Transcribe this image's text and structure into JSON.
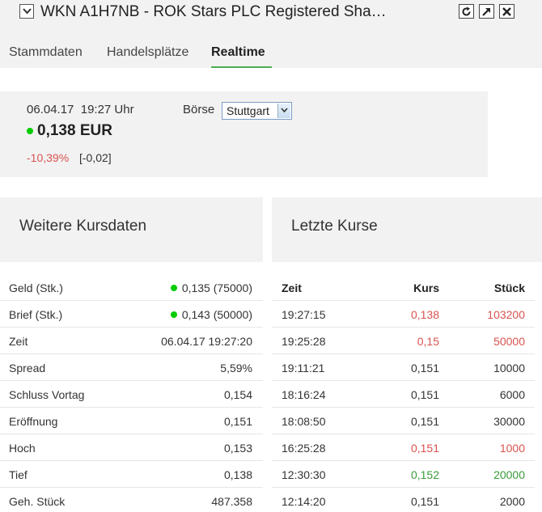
{
  "window": {
    "title": "WKN A1H7NB - ROK Stars PLC Registered Sha…",
    "icons": [
      "chevron-down-icon",
      "refresh-icon",
      "popout-icon",
      "close-icon"
    ]
  },
  "tabs": [
    {
      "label": "Stammdaten",
      "active": false
    },
    {
      "label": "Handelsplätze",
      "active": false
    },
    {
      "label": "Realtime",
      "active": true
    }
  ],
  "quote": {
    "datetime": "06.04.17  19:27 Uhr",
    "price": "0,138 EUR",
    "change_pct": "-10,39%",
    "change_abs": "[-0,02]",
    "exchange_label": "Börse",
    "exchange_selected": "Stuttgart",
    "status_color": "#00cc00"
  },
  "kursdaten": {
    "title": "Weitere Kursdaten",
    "rows": [
      {
        "label": "Geld (Stk.)",
        "value": "0,135 (75000)",
        "dot": true
      },
      {
        "label": "Brief (Stk.)",
        "value": "0,143 (50000)",
        "dot": true
      },
      {
        "label": "Zeit",
        "value": "06.04.17 19:27:20",
        "dot": false
      },
      {
        "label": "Spread",
        "value": "5,59%",
        "dot": false
      },
      {
        "label": "Schluss Vortag",
        "value": "0,154",
        "dot": false
      },
      {
        "label": "Eröffnung",
        "value": "0,151",
        "dot": false
      },
      {
        "label": "Hoch",
        "value": "0,153",
        "dot": false
      },
      {
        "label": "Tief",
        "value": "0,138",
        "dot": false
      },
      {
        "label": "Geh. Stück",
        "value": "487.358",
        "dot": false
      }
    ]
  },
  "letzte_kurse": {
    "title": "Letzte Kurse",
    "headers": {
      "zeit": "Zeit",
      "kurs": "Kurs",
      "stueck": "Stück"
    },
    "rows": [
      {
        "zeit": "19:27:15",
        "kurs": "0,138",
        "stueck": "103200",
        "trend": "red"
      },
      {
        "zeit": "19:25:28",
        "kurs": "0,15",
        "stueck": "50000",
        "trend": "red"
      },
      {
        "zeit": "19:11:21",
        "kurs": "0,151",
        "stueck": "10000",
        "trend": "neutral"
      },
      {
        "zeit": "18:16:24",
        "kurs": "0,151",
        "stueck": "6000",
        "trend": "neutral"
      },
      {
        "zeit": "18:08:50",
        "kurs": "0,151",
        "stueck": "30000",
        "trend": "neutral"
      },
      {
        "zeit": "16:25:28",
        "kurs": "0,151",
        "stueck": "1000",
        "trend": "red"
      },
      {
        "zeit": "12:30:30",
        "kurs": "0,152",
        "stueck": "20000",
        "trend": "green"
      },
      {
        "zeit": "12:14:20",
        "kurs": "0,151",
        "stueck": "2000",
        "trend": "neutral"
      }
    ]
  },
  "colors": {
    "accent": "#4caf50",
    "negative": "#d9534f",
    "positive": "#3a9a3a",
    "panel_bg": "#f2f2f2"
  }
}
